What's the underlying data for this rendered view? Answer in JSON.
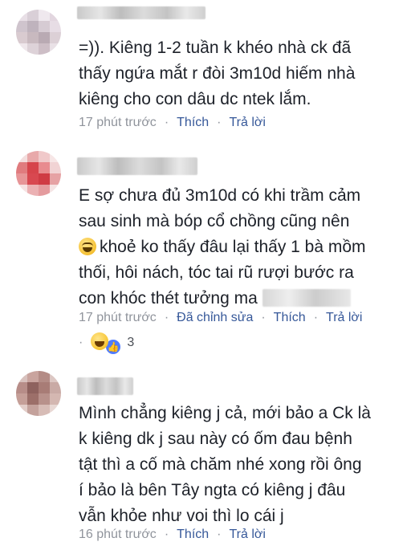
{
  "comments": [
    {
      "text_lines": [
        "=)). Kiêng 1-2 tuần k khéo nhà ck đã",
        "thấy ngứa mắt r đòi 3m10d hiếm nhà",
        "kiêng cho con dâu dc ntek lắm."
      ],
      "time": "17 phút trước",
      "actions": [
        "Thích",
        "Trả lời"
      ]
    },
    {
      "text_lines": [
        "E sợ chưa đủ 3m10d có khi trầm cảm",
        "sau sinh mà bóp cổ chồng cũng nên",
        "khoẻ ko thấy đâu lại thấy 1 bà mồm",
        "thối, hôi nách, tóc tai rũ rượi bước ra",
        "con khóc thét tưởng ma"
      ],
      "time": "17 phút trước",
      "edited": "Đã chỉnh sửa",
      "actions": [
        "Thích",
        "Trả lời"
      ],
      "reaction_count": "3",
      "reaction_icons": [
        "haha-icon",
        "like-icon"
      ]
    },
    {
      "text_lines": [
        "Mình chẳng kiêng j cả, mới bảo a Ck là",
        "k kiêng dk j sau này có ốm đau bệnh",
        "tật thì a cố mà chăm nhé xong rồi ông",
        "í bảo là bên Tây ngta có kiêng j đâu",
        "vẫn khỏe như voi thì lo cái j"
      ],
      "time": "16 phút trước",
      "actions": [
        "Thích",
        "Trả lời"
      ]
    }
  ],
  "colors": {
    "text": "#1d2129",
    "meta_gray": "#90949c",
    "link_blue": "#365899"
  }
}
